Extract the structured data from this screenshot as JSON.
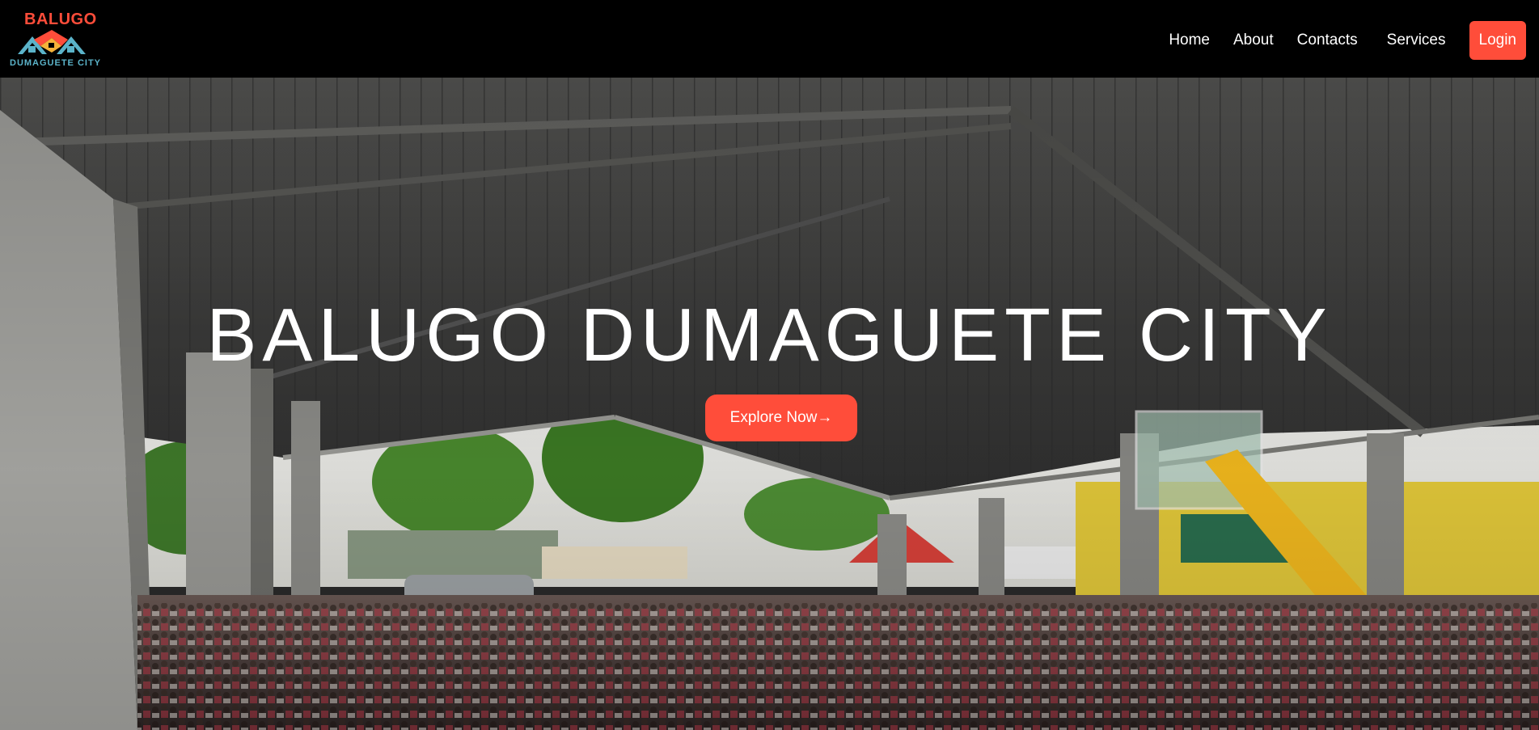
{
  "brand": {
    "name_top": "BALUGO",
    "name_bottom": "DUMAGUETE CITY",
    "colors": {
      "primary": "#ff4d3a",
      "secondary": "#5bb3c9",
      "roof_accent": "#f4b23a"
    }
  },
  "nav": {
    "links": [
      "Home",
      "About",
      "Contacts",
      "Services"
    ],
    "login_label": "Login"
  },
  "hero": {
    "title": "BALUGO DUMAGUETE CITY",
    "cta_label": "Explore Now→",
    "background": "covered-court-crowd-photo"
  },
  "colors": {
    "accent": "#ff4d3a",
    "navbar_bg": "#000000"
  }
}
